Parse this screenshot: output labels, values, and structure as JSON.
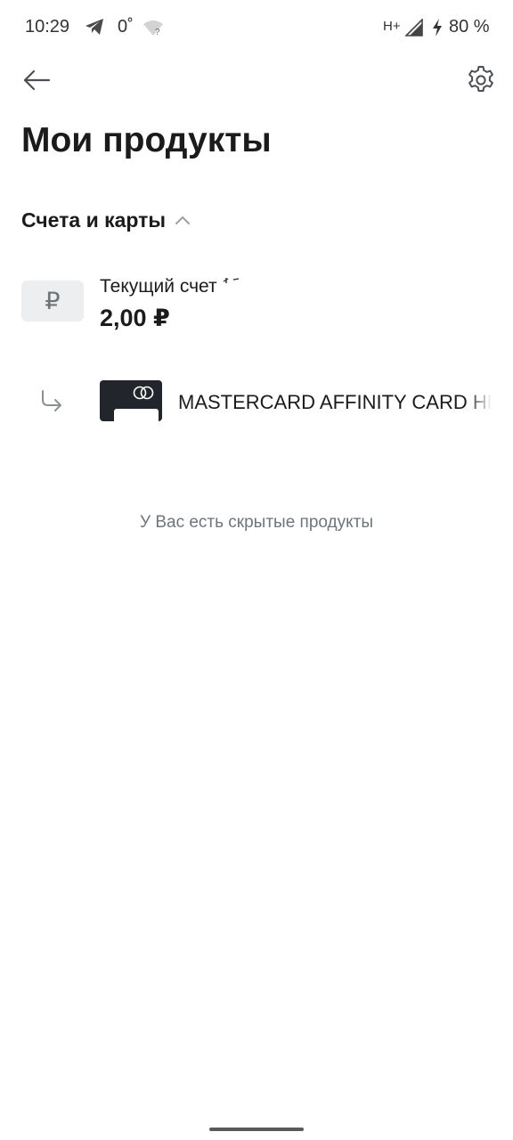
{
  "status_bar": {
    "time": "10:29",
    "temperature": "0˚",
    "network_type": "H+",
    "battery": "80 %",
    "icons": [
      "telegram-icon",
      "wifi-unknown-icon",
      "signal-icon",
      "charging-bolt-icon"
    ]
  },
  "app_bar": {
    "back_icon": "arrow-left-icon",
    "settings_icon": "gear-icon"
  },
  "page": {
    "title": "Мои продукты"
  },
  "section": {
    "label": "Счета и карты",
    "expanded": true,
    "chevron_icon": "chevron-up-icon"
  },
  "account": {
    "name": "Текущий счет",
    "balance": "2,00 ₽",
    "currency_symbol": "₽",
    "icon": "ruble-icon"
  },
  "card": {
    "name": "MASTERCARD AFFINITY CARD НЕ",
    "icon": "subitem-arrow-icon",
    "thumb_color": "#22262c"
  },
  "hidden_products": {
    "text": "У Вас есть скрытые продукты"
  },
  "colors": {
    "background": "#ffffff",
    "text_primary": "#1b1b1b",
    "text_secondary": "#6e757c",
    "badge_bg": "#eceef0"
  }
}
